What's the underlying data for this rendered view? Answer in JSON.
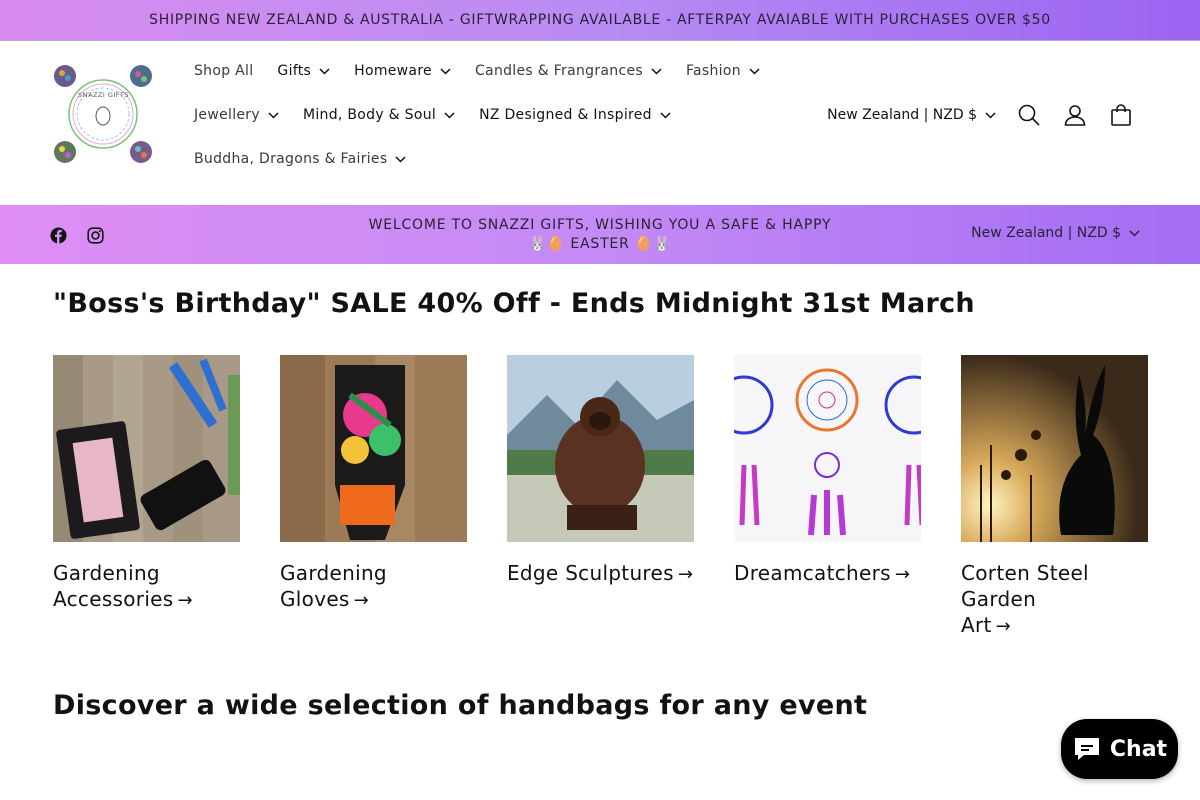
{
  "announcement": "SHIPPING NEW ZEALAND & AUSTRALIA - GIFTWRAPPING AVAILABLE - AFTERPAY AVAIABLE WITH PURCHASES OVER $50",
  "header": {
    "logo_text": "SNAZZI GIFTS",
    "nav_row1": [
      {
        "label": "Shop All",
        "dropdown": false
      },
      {
        "label": "Gifts",
        "dropdown": true
      },
      {
        "label": "Homeware",
        "dropdown": true
      },
      {
        "label": "Candles & Frangrances",
        "dropdown": true
      },
      {
        "label": "Fashion",
        "dropdown": true
      }
    ],
    "nav_row2": [
      {
        "label": "Jewellery",
        "dropdown": true
      },
      {
        "label": "Mind, Body & Soul",
        "dropdown": true
      },
      {
        "label": "NZ Designed & Inspired",
        "dropdown": true
      }
    ],
    "nav_row3": [
      {
        "label": "Buddha, Dragons & Fairies",
        "dropdown": true
      }
    ],
    "locale": "New Zealand | NZD $",
    "icons": [
      "search-icon",
      "account-icon",
      "cart-icon"
    ]
  },
  "welcome_bar": {
    "line1": "WELCOME TO SNAZZI GIFTS, WISHING YOU A SAFE & HAPPY",
    "line2": "🐰🥚 EASTER 🥚🐰",
    "locale": "New Zealand | NZD $",
    "social": [
      "facebook-icon",
      "instagram-icon"
    ]
  },
  "sale_section": {
    "title": "\"Boss's Birthday\" SALE 40% Off - Ends Midnight 31st March",
    "collections": [
      {
        "line1": "Gardening",
        "line2": "Accessories",
        "arrow": "→"
      },
      {
        "line1": "Gardening Gloves",
        "line2": "",
        "arrow": "→"
      },
      {
        "line1": "Edge Sculptures",
        "line2": "",
        "arrow": "→"
      },
      {
        "line1": "Dreamcatchers",
        "line2": "",
        "arrow": "→"
      },
      {
        "line1": "Corten Steel Garden",
        "line2": "Art",
        "arrow": "→"
      }
    ]
  },
  "handbags_section": {
    "title": "Discover a wide selection of handbags for any event"
  },
  "chat": {
    "label": "Chat"
  }
}
